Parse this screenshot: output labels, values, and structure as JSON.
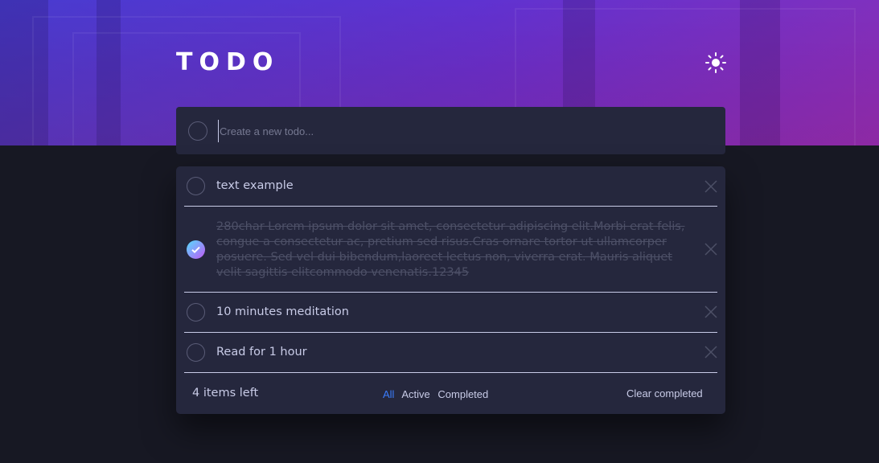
{
  "app": {
    "title": "TODO"
  },
  "create": {
    "placeholder": "Create a new todo..."
  },
  "todos": [
    {
      "text": "text example",
      "completed": false
    },
    {
      "text": "280char Lorem ipsum dolor sit amet, consectetur adipiscing elit.Morbi erat felis, congue a consectetur ac, pretium sed risus.Cras ornare tortor ut ullamcorper posuere. Sed vel dui bibendum,laoreet lectus non, viverra erat. Mauris aliquet velit sagittis elitcommodo venenatis.12345",
      "completed": true
    },
    {
      "text": "10 minutes meditation",
      "completed": false
    },
    {
      "text": "Read for 1 hour",
      "completed": false
    }
  ],
  "footer": {
    "items_left": "4 items left",
    "filters": [
      {
        "label": "All",
        "active": true
      },
      {
        "label": "Active",
        "active": false
      },
      {
        "label": "Completed",
        "active": false
      }
    ],
    "clear_label": "Clear completed"
  },
  "icons": {
    "theme": "sun-icon",
    "check": "check-icon",
    "delete": "cross-icon"
  },
  "colors": {
    "background": "#171823",
    "card": "#25273d",
    "text": "#c8cbe7",
    "completed_text": "#4d5067",
    "active_filter": "#3a7cfd",
    "check_gradient_start": "#55ddff",
    "check_gradient_end": "#c058f3"
  }
}
